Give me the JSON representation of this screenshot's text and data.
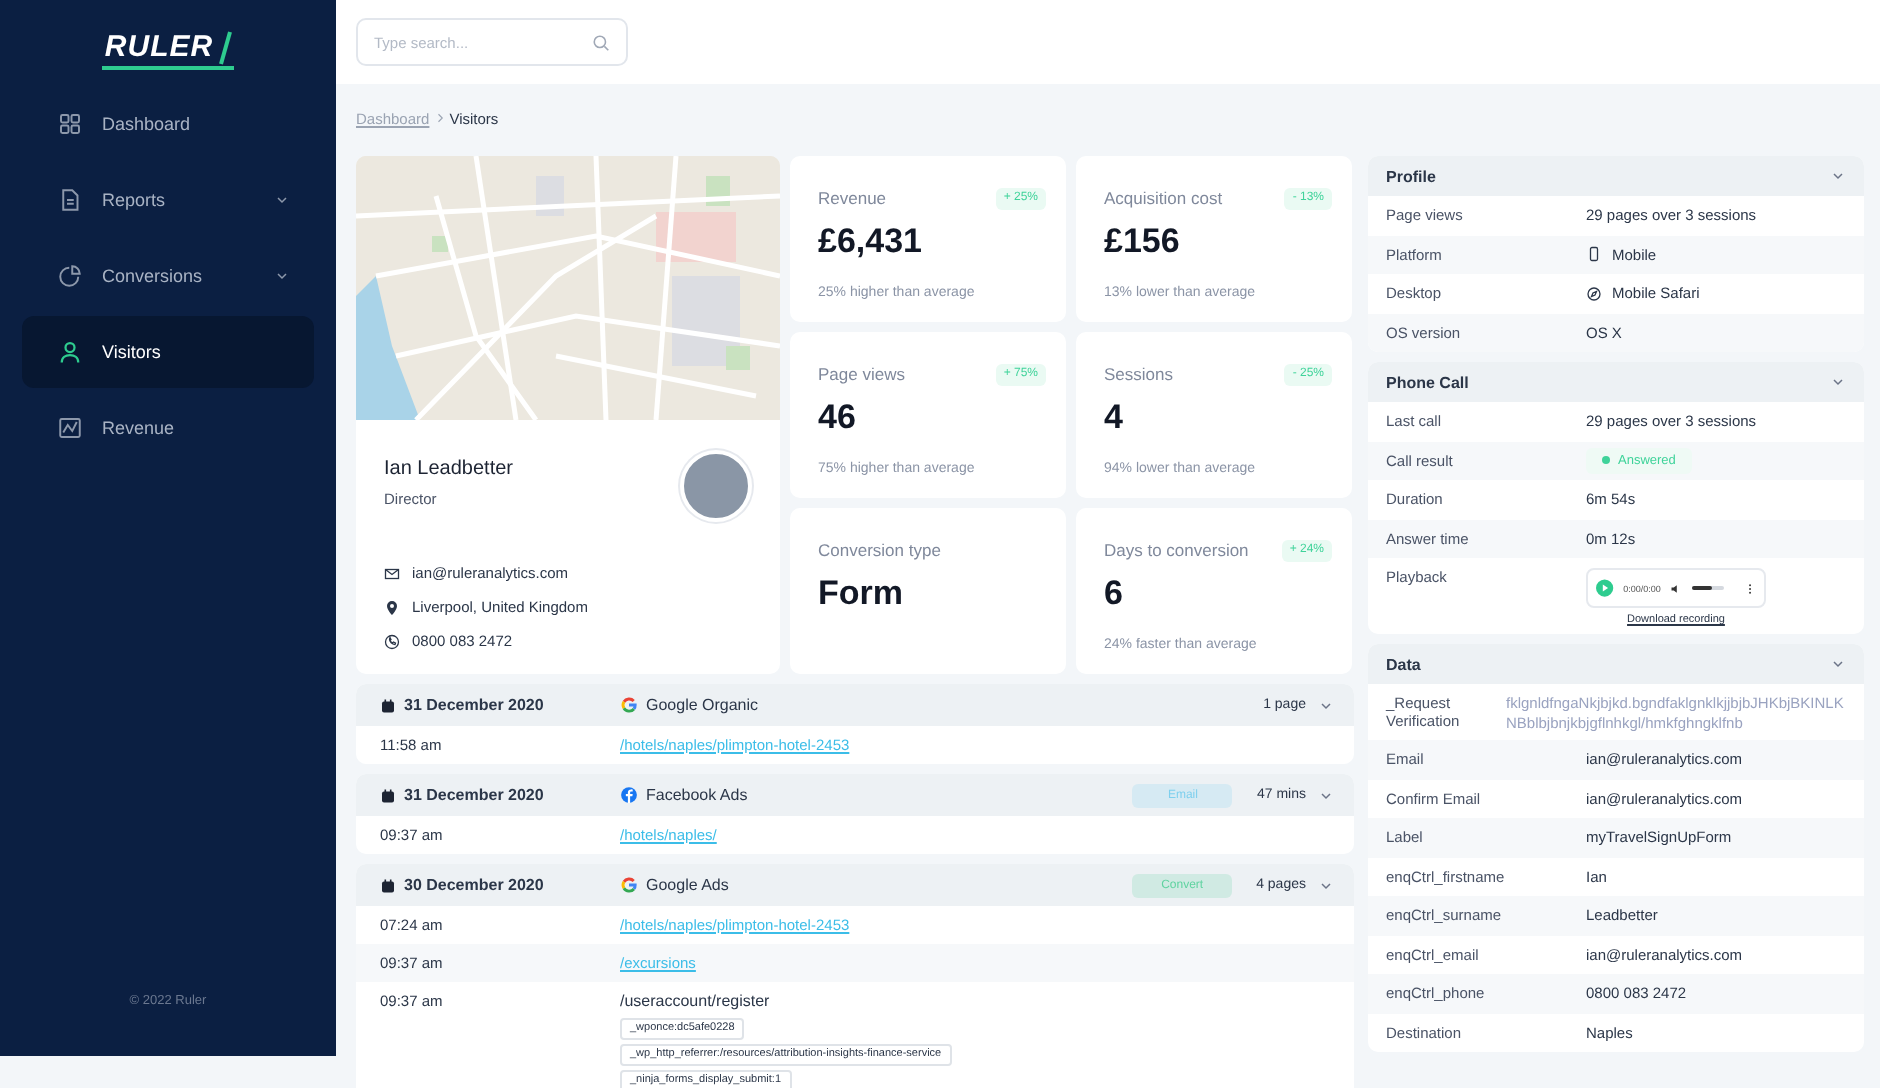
{
  "sidebar": {
    "logo": "RULER",
    "items": [
      {
        "label": "Dashboard",
        "expandable": false,
        "selected": false
      },
      {
        "label": "Reports",
        "expandable": true,
        "selected": false
      },
      {
        "label": "Conversions",
        "expandable": true,
        "selected": false
      },
      {
        "label": "Visitors",
        "expandable": false,
        "selected": true
      },
      {
        "label": "Revenue",
        "expandable": false,
        "selected": false
      }
    ],
    "footer": "© 2022 Ruler"
  },
  "search": {
    "placeholder": "Type search..."
  },
  "breadcrumb": [
    {
      "label": "Dashboard",
      "kind": "link"
    },
    {
      "label": "Visitors",
      "kind": "current"
    }
  ],
  "visitor": {
    "name": "Ian Leadbetter",
    "role": "Director",
    "contacts": [
      {
        "kind": "email",
        "text": "ian@ruleranalytics.com"
      },
      {
        "kind": "location",
        "text": "Liverpool, United Kingdom"
      },
      {
        "kind": "phone",
        "text": "0800 083 2472"
      }
    ]
  },
  "stats": [
    {
      "label": "Revenue",
      "value": "£6,431",
      "badge": "+ 25%",
      "note": "25% higher than average"
    },
    {
      "label": "Acquisition cost",
      "value": "£156",
      "badge": "- 13%",
      "note": "13% lower than average"
    },
    {
      "label": "Page views",
      "value": "46",
      "badge": "+ 75%",
      "note": "75% higher than average"
    },
    {
      "label": "Sessions",
      "value": "4",
      "badge": "- 25%",
      "note": "94% lower than average"
    },
    {
      "label": "Conversion type",
      "value": "Form"
    },
    {
      "label": "Days to conversion",
      "value": "6",
      "badge": "+ 24%",
      "note": "24% faster than average"
    }
  ],
  "sessions": [
    {
      "date": "31 December 2020",
      "source": {
        "name": "Google Organic",
        "kind": "google"
      },
      "count": "1 page",
      "pages": [
        {
          "time": "11:58 am",
          "kind": "link",
          "path": "/hotels/naples/plimpton-hotel-2453"
        }
      ]
    },
    {
      "date": "31 December 2020",
      "source": {
        "name": "Facebook Ads",
        "kind": "facebook"
      },
      "tag": {
        "label": "Email",
        "color": "#7fd0ee"
      },
      "count": "47 mins",
      "pages": [
        {
          "time": "09:37 am",
          "kind": "link",
          "path": "/hotels/naples/"
        }
      ]
    },
    {
      "date": "30 December 2020",
      "source": {
        "name": "Google Ads",
        "kind": "google"
      },
      "tag": {
        "label": "Convert",
        "color": "#5fd3a0"
      },
      "count": "4 pages",
      "pages": [
        {
          "time": "07:24 am",
          "kind": "link",
          "path": "/hotels/naples/plimpton-hotel-2453"
        },
        {
          "time": "09:37 am",
          "kind": "link",
          "path": "/excursions"
        },
        {
          "time": "09:37 am",
          "kind": "text",
          "path": "/useraccount/register",
          "params": [
            "_wponce:dc5afe0228",
            "_wp_http_referrer:/resources/attribution-insights-finance-service",
            "_ninja_forms_display_submit:1"
          ]
        }
      ]
    }
  ],
  "panels": [
    {
      "title": "Profile",
      "rows": [
        {
          "label": "Page views",
          "kind": "text",
          "value": "29 pages over 3 sessions"
        },
        {
          "label": "Platform",
          "kind": "device",
          "value": "Mobile"
        },
        {
          "label": "Desktop",
          "kind": "browser",
          "value": "Mobile Safari"
        },
        {
          "label": "OS version",
          "kind": "text",
          "value": "OS X"
        }
      ]
    },
    {
      "title": "Phone Call",
      "rows": [
        {
          "label": "Last call",
          "kind": "text",
          "value": "29 pages over 3 sessions"
        },
        {
          "label": "Call result",
          "kind": "status",
          "value": "Answered"
        },
        {
          "label": "Duration",
          "kind": "text",
          "value": "6m 54s"
        },
        {
          "label": "Answer time",
          "kind": "text",
          "value": "0m 12s"
        },
        {
          "label": "Playback",
          "kind": "player",
          "time": "0:00/0:00",
          "level": 0.6,
          "link": "Download recording"
        }
      ]
    },
    {
      "title": "Data",
      "rows": [
        {
          "label": "_Request Verification",
          "kind": "code",
          "value": "fklgnldfngaNkjbjkd.bgndfaklgnklkjjbjbJHKbjBKINLKNBblbjbnjkbjgflnhkgl/hmkfghngklfnb"
        },
        {
          "label": "Email",
          "kind": "text",
          "value": "ian@ruleranalytics.com"
        },
        {
          "label": "Confirm Email",
          "kind": "text",
          "value": "ian@ruleranalytics.com"
        },
        {
          "label": "Label",
          "kind": "text",
          "value": "myTravelSignUpForm"
        },
        {
          "label": "enqCtrl_firstname",
          "kind": "text",
          "value": "Ian"
        },
        {
          "label": "enqCtrl_surname",
          "kind": "text",
          "value": "Leadbetter"
        },
        {
          "label": "enqCtrl_email",
          "kind": "text",
          "value": "ian@ruleranalytics.com"
        },
        {
          "label": "enqCtrl_phone",
          "kind": "text",
          "value": "0800 083 2472"
        },
        {
          "label": "Destination",
          "kind": "text",
          "value": "Naples"
        }
      ]
    }
  ]
}
